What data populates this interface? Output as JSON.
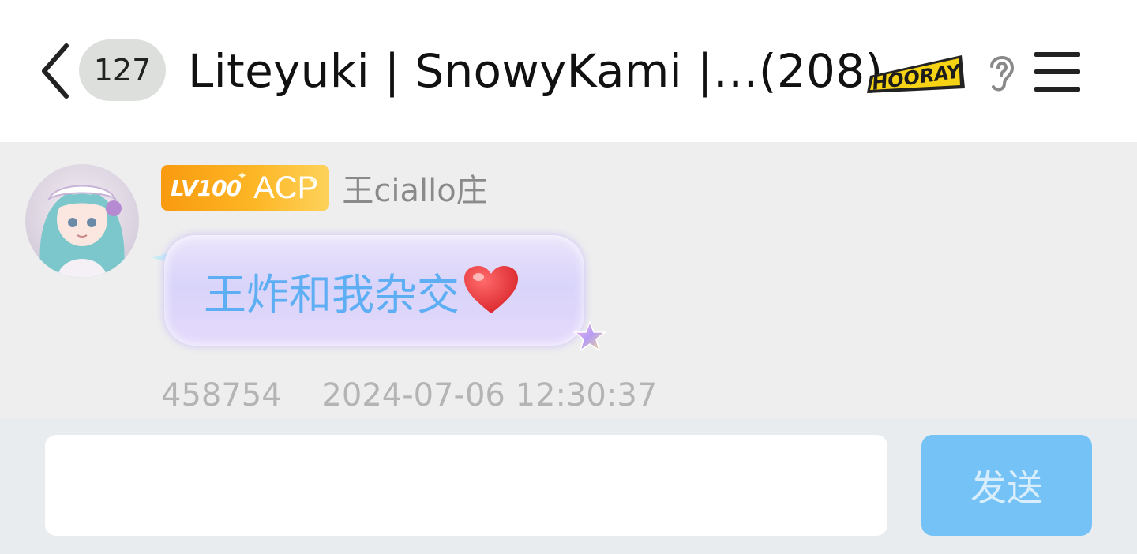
{
  "header": {
    "back_icon": "chevron-left-icon",
    "unread_count": "127",
    "title": "Liteyuki | SnowyKami |…(208)",
    "hooray_badge_text": "HOORAY",
    "ear_icon": "ear-icon",
    "menu_icon": "hamburger-menu-icon"
  },
  "message": {
    "level_label": "LV100",
    "title_label": "ACP",
    "sender_name": "王ciallo庄",
    "text": "王炸和我杂交",
    "emoji": "heart-icon",
    "message_id": "458754",
    "timestamp": "2024-07-06 12:30:37"
  },
  "input": {
    "value": "",
    "placeholder": "",
    "send_label": "发送"
  },
  "colors": {
    "accent": "#75c2f6",
    "bubble_text": "#5eaef3",
    "level_badge": "#fdb625"
  }
}
